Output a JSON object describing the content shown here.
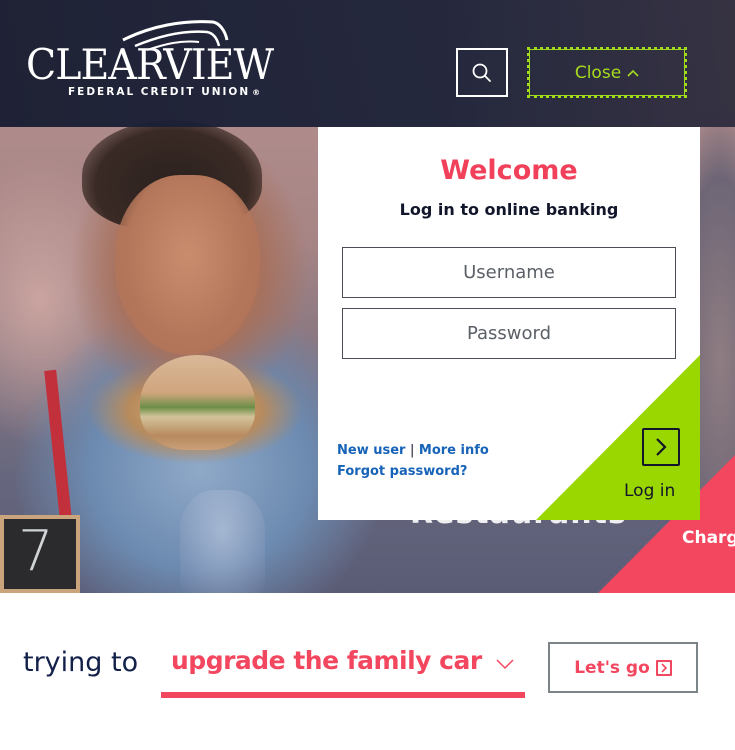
{
  "brand": {
    "name": "CLEARVIEW",
    "subtitle": "FEDERAL CREDIT UNION",
    "registered": "®"
  },
  "header": {
    "search_icon": "search-icon",
    "close_label": "Close",
    "close_icon": "chevron-up-icon"
  },
  "login": {
    "title": "Welcome",
    "subtitle": "Log in to online banking",
    "username_placeholder": "Username",
    "username_value": "",
    "password_placeholder": "Password",
    "password_value": "",
    "new_user_label": "New user",
    "separator": "|",
    "more_info_label": "More info",
    "forgot_password_label": "Forgot password?",
    "submit_label": "Log in",
    "submit_icon": "chevron-right-box-icon"
  },
  "hero": {
    "table_number": "7",
    "promo_label": "Charg",
    "promo_text_behind": "Restaurants"
  },
  "goal_bar": {
    "prefix": "trying to",
    "selected_goal": "upgrade the family car",
    "dropdown_icon": "chevron-down-icon",
    "cta_label": "Let's go",
    "cta_icon": "chevron-right-box-icon"
  },
  "colors": {
    "accent_pink": "#f3465f",
    "accent_green": "#9ad600",
    "header_navy": "#1c2238",
    "link_blue": "#1663b8",
    "text_dark": "#12162a"
  }
}
